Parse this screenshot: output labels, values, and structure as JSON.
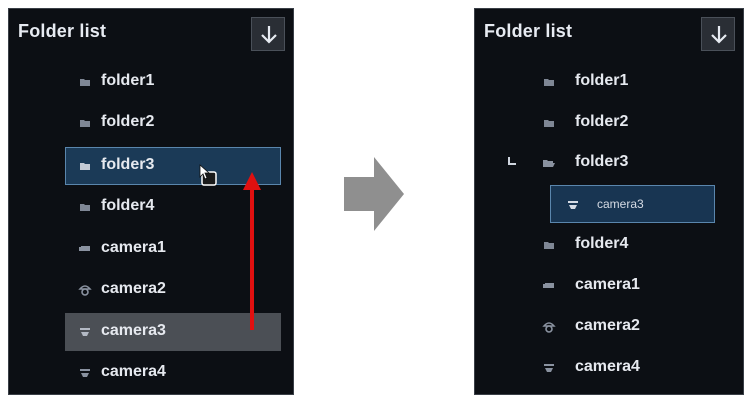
{
  "left_panel": {
    "title": "Folder list",
    "download_icon": "arrow-down-icon",
    "items": [
      {
        "label": "folder1",
        "icon": "folder-icon",
        "state": "normal"
      },
      {
        "label": "folder2",
        "icon": "folder-icon",
        "state": "normal"
      },
      {
        "label": "folder3",
        "icon": "folder-icon",
        "state": "selected"
      },
      {
        "label": "folder4",
        "icon": "folder-icon",
        "state": "normal"
      },
      {
        "label": "camera1",
        "icon": "box-camera-icon",
        "state": "normal"
      },
      {
        "label": "camera2",
        "icon": "dome-camera-icon",
        "state": "normal"
      },
      {
        "label": "camera3",
        "icon": "ceiling-camera-icon",
        "state": "dragging"
      },
      {
        "label": "camera4",
        "icon": "ceiling-camera-icon",
        "state": "normal"
      }
    ]
  },
  "right_panel": {
    "title": "Folder list",
    "download_icon": "arrow-down-icon",
    "items": [
      {
        "label": "folder1",
        "icon": "folder-icon",
        "state": "normal"
      },
      {
        "label": "folder2",
        "icon": "folder-icon",
        "state": "normal"
      },
      {
        "label": "folder3",
        "icon": "open-folder-icon",
        "state": "expanded"
      },
      {
        "label": "camera3",
        "icon": "ceiling-camera-icon",
        "state": "selected-child"
      },
      {
        "label": "folder4",
        "icon": "folder-icon",
        "state": "normal"
      },
      {
        "label": "camera1",
        "icon": "box-camera-icon",
        "state": "normal"
      },
      {
        "label": "camera2",
        "icon": "dome-camera-icon",
        "state": "normal"
      },
      {
        "label": "camera4",
        "icon": "ceiling-camera-icon",
        "state": "normal"
      }
    ]
  },
  "transition_icon": "right-arrow-icon",
  "drag_indicator": "red-up-arrow-icon",
  "colors": {
    "panel_bg": "#0c0f14",
    "selected_bg": "#1b3a57",
    "selected_border": "#5a86ad",
    "drag_bg": "#4b4f55",
    "drag_arrow": "#e01010",
    "text": "#e6e9ef"
  }
}
